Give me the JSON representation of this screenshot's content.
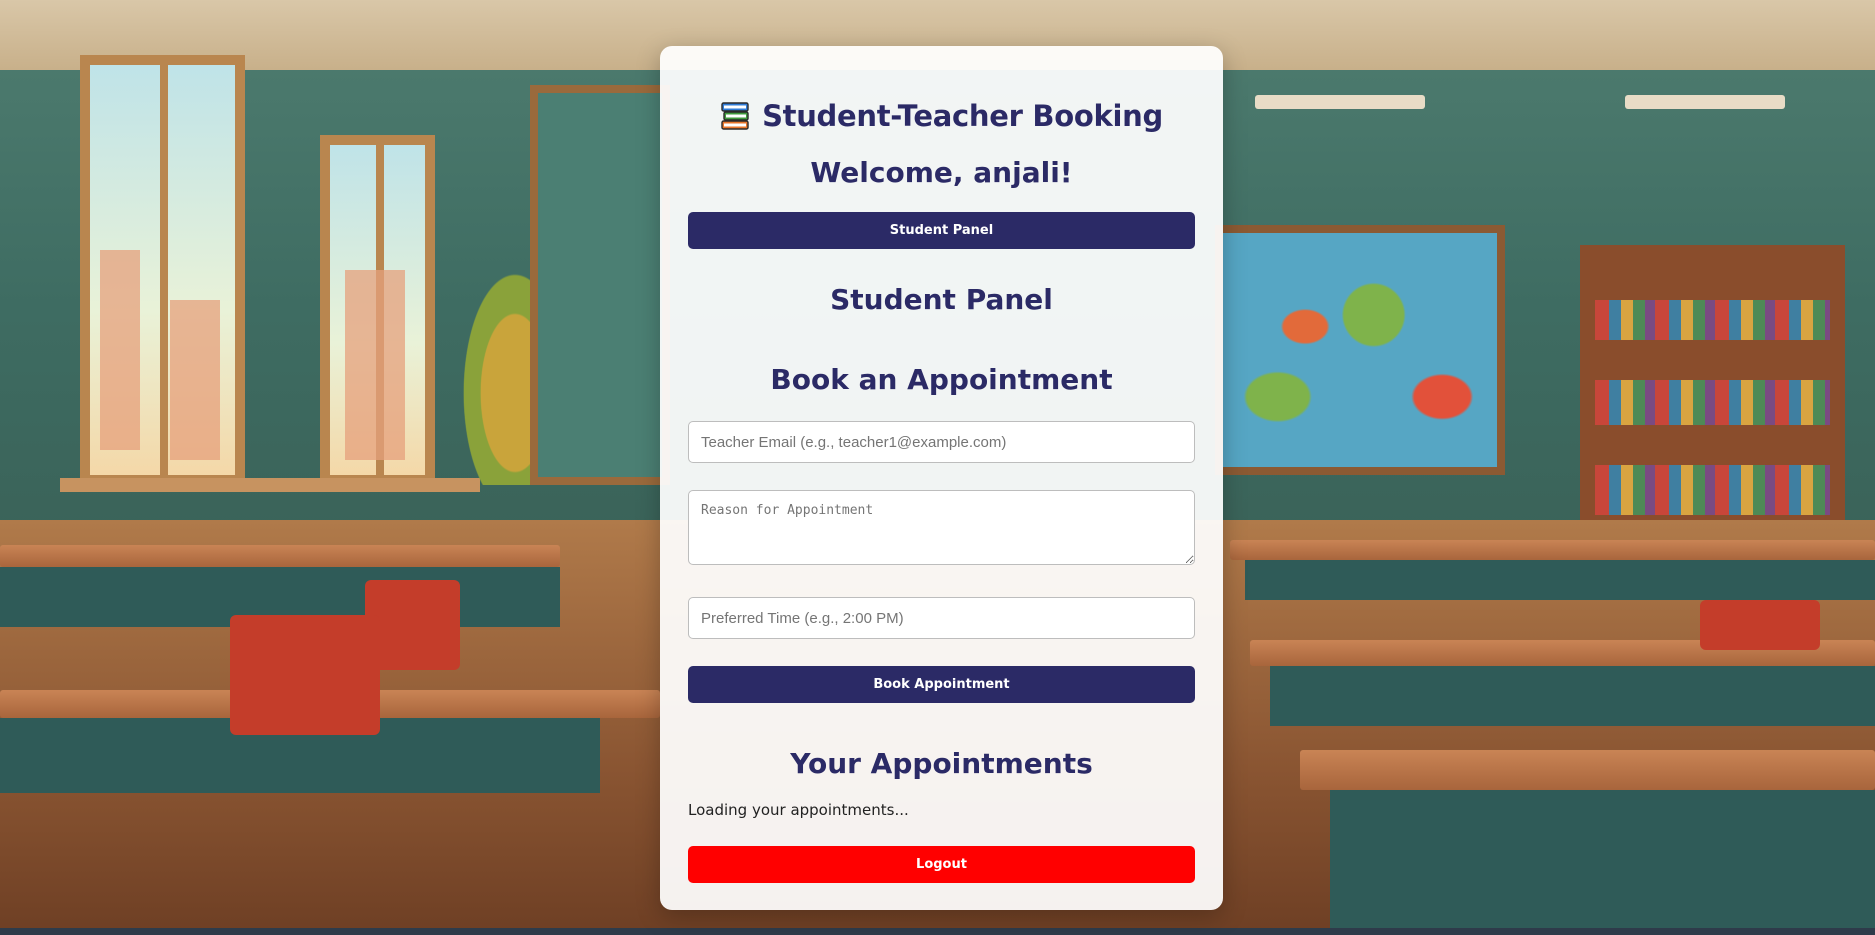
{
  "app": {
    "icon": "books-icon",
    "title": "Student-Teacher Booking"
  },
  "welcome_text": "Welcome, anjali!",
  "panel_button_label": "Student Panel",
  "student_panel_heading": "Student Panel",
  "booking": {
    "heading": "Book an Appointment",
    "teacher_email_placeholder": "Teacher Email (e.g., teacher1@example.com)",
    "teacher_email_value": "",
    "reason_placeholder": "Reason for Appointment",
    "reason_value": "",
    "time_placeholder": "Preferred Time (e.g., 2:00 PM)",
    "time_value": "",
    "submit_label": "Book Appointment"
  },
  "appointments": {
    "heading": "Your Appointments",
    "status_text": "Loading your appointments..."
  },
  "logout_label": "Logout",
  "colors": {
    "primary": "#2b2a66",
    "danger": "#ff0000",
    "card_background": "#ffffff"
  }
}
